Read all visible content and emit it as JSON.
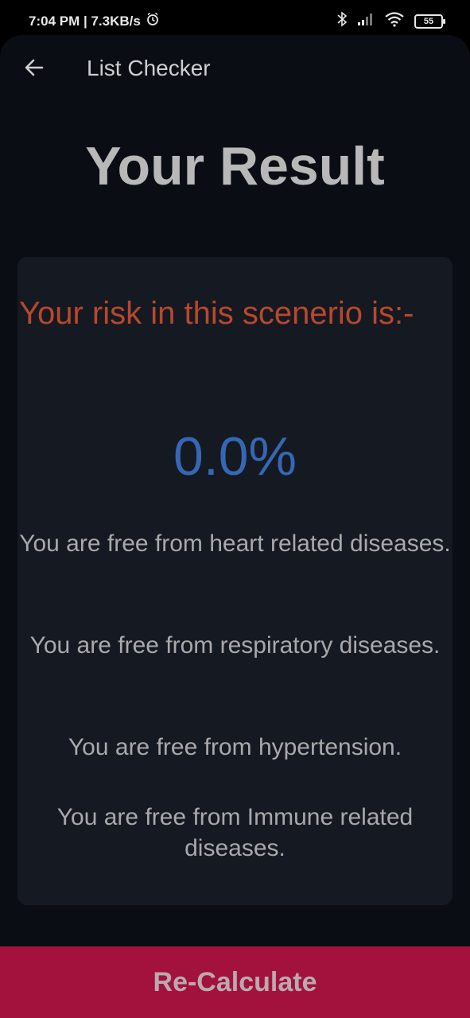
{
  "status_bar": {
    "time_speed": "7:04 PM | 7.3KB/s",
    "battery_level": "55"
  },
  "toolbar": {
    "title": "List Checker"
  },
  "page": {
    "title": "Your Result"
  },
  "result": {
    "risk_label": "Your risk in this scenerio is:-",
    "risk_value": "0.0%",
    "messages": [
      "You are free from heart related diseases.",
      "You are free from respiratory diseases.",
      "You are free from hypertension.",
      "You are free from Immune related diseases."
    ]
  },
  "actions": {
    "recalculate_label": "Re-Calculate"
  },
  "colors": {
    "background": "#0a0d14",
    "card": "#151922",
    "risk_label": "#b8482c",
    "risk_value": "#3667b3",
    "button": "#a3123c"
  }
}
